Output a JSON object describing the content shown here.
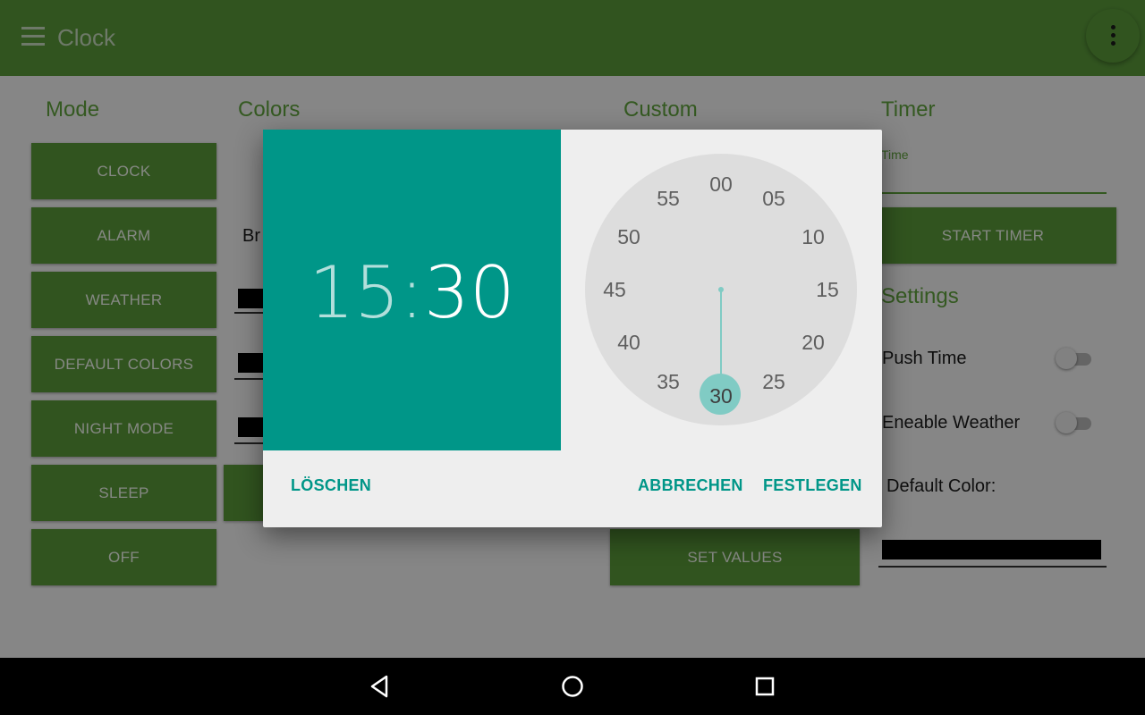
{
  "appbar": {
    "title": "Clock",
    "menu_icon": "hamburger-menu-icon",
    "overflow_icon": "more-vert-icon",
    "color": "#5a9a3a"
  },
  "mode": {
    "heading": "Mode",
    "buttons": [
      "CLOCK",
      "ALARM",
      "WEATHER",
      "DEFAULT COLORS",
      "NIGHT MODE",
      "SLEEP",
      "OFF"
    ]
  },
  "colors": {
    "heading": "Colors",
    "partial_label": "Br"
  },
  "custom": {
    "heading": "Custom",
    "set_values": "SET VALUES"
  },
  "timer": {
    "heading": "Timer",
    "time_label": "Time",
    "start_button": "START TIMER"
  },
  "settings": {
    "heading": "Settings",
    "push_time": "Push Time",
    "push_time_on": false,
    "enable_weather": "Eneable Weather",
    "enable_weather_on": false,
    "default_color_label": "Default Color:",
    "default_color_value": "#000000"
  },
  "dialog": {
    "hour": "15",
    "separator": ":",
    "minute": "30",
    "selected_minute": "30",
    "minute_labels": [
      "00",
      "05",
      "10",
      "15",
      "20",
      "25",
      "30",
      "35",
      "40",
      "45",
      "50",
      "55"
    ],
    "clear": "LÖSCHEN",
    "cancel": "ABBRECHEN",
    "set": "FESTLEGEN",
    "accent": "#009688"
  },
  "navbar": {
    "back_icon": "back-triangle-icon",
    "home_icon": "home-circle-icon",
    "recents_icon": "recents-square-icon"
  }
}
